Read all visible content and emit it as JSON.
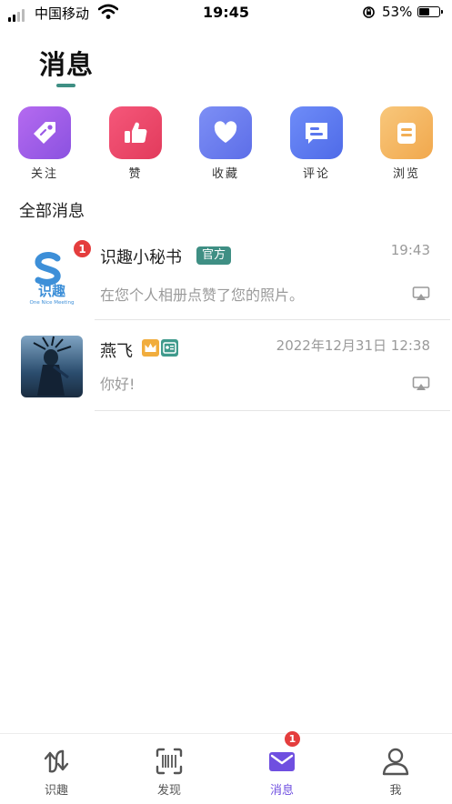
{
  "status_bar": {
    "carrier": "中国移动",
    "time": "19:45",
    "battery": "53%"
  },
  "page_title": "消息",
  "categories": [
    {
      "label": "关注",
      "icon": "tag-icon",
      "color": "#a05ee8"
    },
    {
      "label": "赞",
      "icon": "thumbs-up-icon",
      "color": "#ee4a6a"
    },
    {
      "label": "收藏",
      "icon": "heart-icon",
      "color": "#6b7df0"
    },
    {
      "label": "评论",
      "icon": "comment-icon",
      "color": "#5f7cf2"
    },
    {
      "label": "浏览",
      "icon": "browse-icon",
      "color": "#f4b35c"
    }
  ],
  "section_title": "全部消息",
  "messages": [
    {
      "name": "识趣小秘书",
      "tag": "官方",
      "time": "19:43",
      "preview": "在您个人相册点赞了您的照片。",
      "unread": "1",
      "avatar_brand": "识趣",
      "avatar_sub": "One Nice Meeting"
    },
    {
      "name": "燕飞",
      "time": "2022年12月31日 12:38",
      "preview": "你好!"
    }
  ],
  "tabs": [
    {
      "label": "识趣",
      "icon": "switch-arrows-icon"
    },
    {
      "label": "发现",
      "icon": "scan-icon"
    },
    {
      "label": "消息",
      "icon": "mail-icon",
      "badge": "1",
      "active": true
    },
    {
      "label": "我",
      "icon": "person-icon"
    }
  ],
  "colors": {
    "accent": "#3f8f84",
    "active_tab": "#6f4fe0",
    "badge": "#e43d3d"
  }
}
